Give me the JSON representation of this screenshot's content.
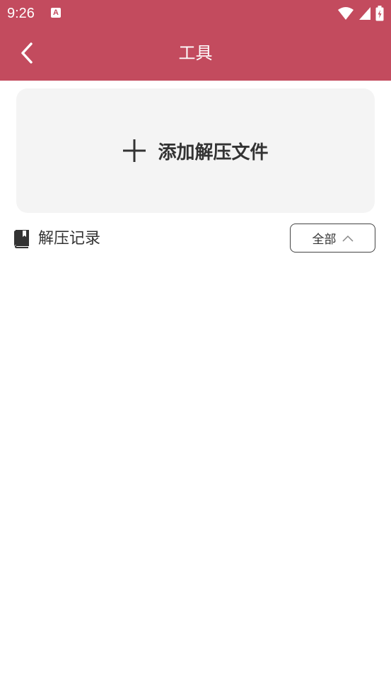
{
  "status_bar": {
    "time": "9:26",
    "notification_icon": "A"
  },
  "toolbar": {
    "title": "工具",
    "back_icon": "back-arrow-icon"
  },
  "add_card": {
    "label": "添加解压文件",
    "icon": "plus-icon"
  },
  "records": {
    "label": "解压记录",
    "icon": "book-icon",
    "filter": {
      "label": "全部",
      "icon": "chevron-up-icon"
    }
  },
  "colors": {
    "primary": "#c34b5e",
    "card_bg": "#f4f4f4",
    "text": "#333333"
  }
}
